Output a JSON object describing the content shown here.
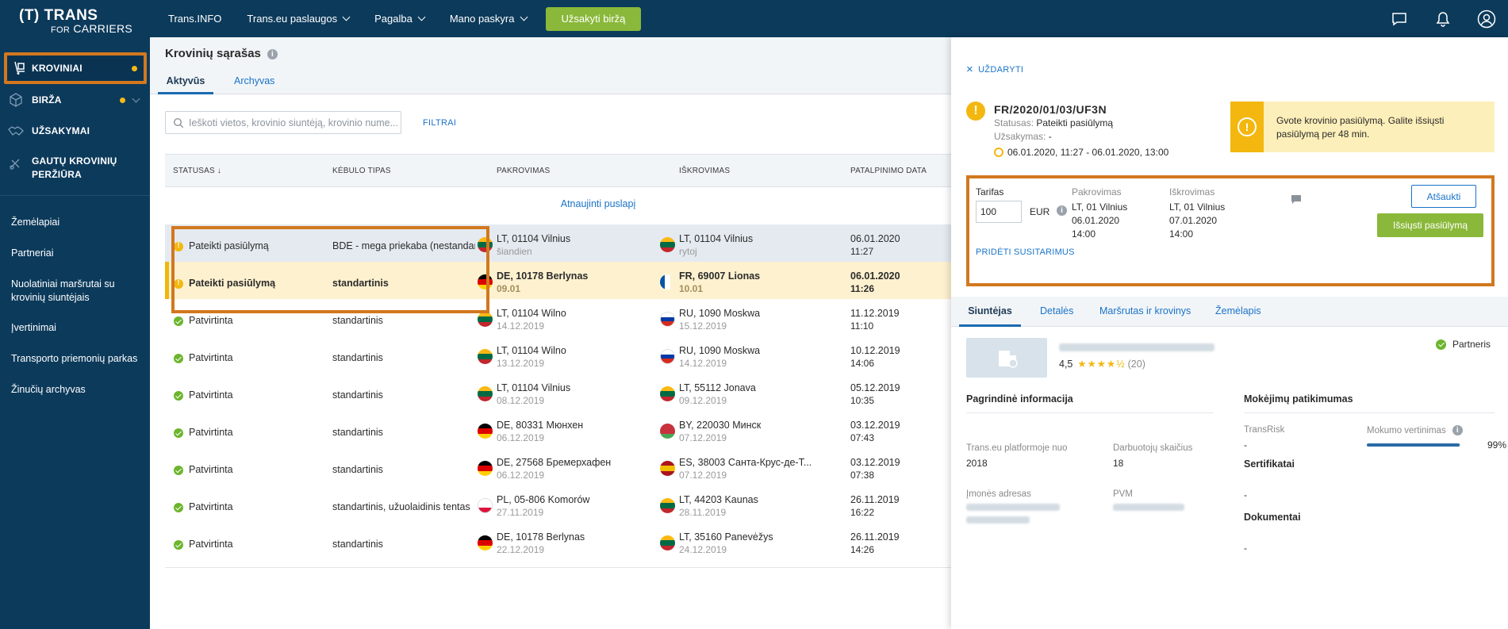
{
  "brand": {
    "line1": "(T) TRANS",
    "line2_for": "FOR",
    "line2_carriers": "CARRIERS"
  },
  "topnav": {
    "items": [
      "Trans.INFO",
      "Trans.eu paslaugos",
      "Pagalba",
      "Mano paskyra"
    ],
    "order_button": "Užsakyti biržą"
  },
  "sidebar": {
    "primary": [
      "KROVINIAI",
      "BIRŽA",
      "UŽSAKYMAI",
      "GAUTŲ KROVINIŲ PERŽIŪRA"
    ],
    "secondary": [
      "Žemėlapiai",
      "Partneriai",
      "Nuolatiniai maršrutai su krovinių siuntėjais",
      "Įvertinimai",
      "Transporto priemonių parkas",
      "Žinučių archyvas"
    ]
  },
  "main": {
    "title": "Krovinių sąrašas",
    "tabs": [
      "Aktyvūs",
      "Archyvas"
    ],
    "search_placeholder": "Ieškoti vietos, krovinio siuntėją, krovinio nume...",
    "filter": "FILTRAI",
    "columns": [
      "STATUSAS ↓",
      "KĖBULO TIPAS",
      "PAKROVIMAS",
      "IŠKROVIMAS",
      "PATALPINIMO DATA"
    ],
    "refresh": "Atnaujinti puslapį",
    "rows": [
      {
        "status": "Pateikti pasiūlymą",
        "kind": "warn",
        "body": "BDE - mega priekaba (nestandar...",
        "load": "LT, 01104 Vilnius",
        "load_date": "šiandien",
        "unload": "LT, 01104 Vilnius",
        "unload_date": "rytoj",
        "posted_d": "06.01.2020",
        "posted_t": "11:27",
        "style": "hl",
        "lf": "lt",
        "uf": "lt"
      },
      {
        "status": "Pateikti pasiūlymą",
        "kind": "warn",
        "body": "standartinis",
        "load": "DE, 10178 Berlynas",
        "load_date": "09.01",
        "unload": "FR, 69007 Lionas",
        "unload_date": "10.01",
        "posted_d": "06.01.2020",
        "posted_t": "11:26",
        "style": "sel",
        "lf": "de",
        "uf": "fr"
      },
      {
        "status": "Patvirtinta",
        "kind": "ok",
        "body": "standartinis",
        "load": "LT, 01104 Wilno",
        "load_date": "14.12.2019",
        "unload": "RU, 1090 Moskwa",
        "unload_date": "15.12.2019",
        "posted_d": "11.12.2019",
        "posted_t": "11:10",
        "style": "",
        "lf": "lt",
        "uf": "ru"
      },
      {
        "status": "Patvirtinta",
        "kind": "ok",
        "body": "standartinis",
        "load": "LT, 01104 Wilno",
        "load_date": "13.12.2019",
        "unload": "RU, 1090 Moskwa",
        "unload_date": "14.12.2019",
        "posted_d": "10.12.2019",
        "posted_t": "14:06",
        "style": "",
        "lf": "lt",
        "uf": "ru"
      },
      {
        "status": "Patvirtinta",
        "kind": "ok",
        "body": "standartinis",
        "load": "LT, 01104 Vilnius",
        "load_date": "08.12.2019",
        "unload": "LT, 55112 Jonava",
        "unload_date": "09.12.2019",
        "posted_d": "05.12.2019",
        "posted_t": "10:35",
        "style": "",
        "lf": "lt",
        "uf": "lt"
      },
      {
        "status": "Patvirtinta",
        "kind": "ok",
        "body": "standartinis",
        "load": "DE, 80331 Мюнхен",
        "load_date": "06.12.2019",
        "unload": "BY, 220030 Минск",
        "unload_date": "07.12.2019",
        "posted_d": "03.12.2019",
        "posted_t": "07:43",
        "style": "",
        "lf": "de",
        "uf": "by"
      },
      {
        "status": "Patvirtinta",
        "kind": "ok",
        "body": "standartinis",
        "load": "DE, 27568 Бремерхафен",
        "load_date": "06.12.2019",
        "unload": "ES, 38003 Санта-Крус-де-Т...",
        "unload_date": "07.12.2019",
        "posted_d": "03.12.2019",
        "posted_t": "07:38",
        "style": "",
        "lf": "de",
        "uf": "es"
      },
      {
        "status": "Patvirtinta",
        "kind": "ok",
        "body": "standartinis, užuolaidinis tentas",
        "load": "PL, 05-806 Komorów",
        "load_date": "27.11.2019",
        "unload": "LT, 44203 Kaunas",
        "unload_date": "28.11.2019",
        "posted_d": "26.11.2019",
        "posted_t": "16:22",
        "style": "",
        "lf": "pl",
        "uf": "lt"
      },
      {
        "status": "Patvirtinta",
        "kind": "ok",
        "body": "standartinis",
        "load": "DE, 10178 Berlynas",
        "load_date": "22.12.2019",
        "unload": "LT, 35160 Panevėžys",
        "unload_date": "24.12.2019",
        "posted_d": "26.11.2019",
        "posted_t": "14:26",
        "style": "",
        "lf": "de",
        "uf": "lt"
      }
    ]
  },
  "panel": {
    "close": "UŽDARYTI",
    "ref": "FR/2020/01/03/UF3N",
    "status_key": "Statusas:",
    "status_val": "Pateikti pasiūlymą",
    "order_key": "Užsakymas:",
    "order_val": "-",
    "time_window": "06.01.2020, 11:27 - 06.01.2020, 13:00",
    "alert": "Gvote krovinio pasiūlymą. Galite išsiųsti pasiūlymą per 48 min.",
    "offer": {
      "tariff_label": "Tarifas",
      "tariff_value": "100",
      "currency": "EUR",
      "load_label": "Pakrovimas",
      "load_place": "LT, 01 Vilnius",
      "load_date": "06.01.2020",
      "load_time": "14:00",
      "unload_label": "Iškrovimas",
      "unload_place": "LT, 01 Vilnius",
      "unload_date": "07.01.2020",
      "unload_time": "14:00",
      "cancel": "Atšaukti",
      "send": "Išsiųsti pasiūlymą",
      "add_terms": "PRIDĖTI SUSITARIMUS"
    },
    "tabs": [
      "Siuntėjas",
      "Detalės",
      "Maršrutas ir krovinys",
      "Žemėlapis"
    ],
    "rating": "4,5",
    "stars": "★★★★½",
    "rating_count": "(20)",
    "partner": "Partneris",
    "basic_info": "Pagrindinė informacija",
    "since_key": "Trans.eu platformoje nuo",
    "since_val": "2018",
    "employees_key": "Darbuotojų skaičius",
    "employees_val": "18",
    "address_key": "Įmonės adresas",
    "vat_key": "PVM",
    "payment_title": "Mokėjimų patikimumas",
    "transrisk_key": "TransRisk",
    "transrisk_val": "-",
    "pay_rating_key": "Mokumo vertinimas",
    "pay_rating_pct": "99%",
    "pay_rating_fraction": 0.99,
    "certs_title": "Sertifikatai",
    "certs_val": "-",
    "docs_title": "Dokumentai",
    "docs_val": "-"
  },
  "flags": {
    "lt": [
      "#fdb913",
      "#006a44",
      "#c1272d"
    ],
    "de": [
      "#000000",
      "#dd0000",
      "#ffce00"
    ],
    "ru": [
      "#ffffff",
      "#0039a6",
      "#d52b1e"
    ],
    "by": [
      "#c8313e",
      "#c8313e",
      "#4aa657"
    ],
    "es": [
      "#aa151b",
      "#f1bf00",
      "#aa151b"
    ],
    "pl": [
      "#ffffff",
      "#ffffff",
      "#dc143c"
    ],
    "fr": [
      "#0055a4",
      "#ffffff",
      "#ef4135"
    ]
  }
}
